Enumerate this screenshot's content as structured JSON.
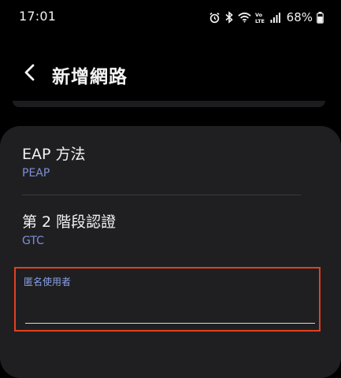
{
  "status_bar": {
    "time": "17:01",
    "battery_percent": "68%",
    "icons": [
      "alarm-icon",
      "bluetooth-icon",
      "wifi-icon",
      "volte-icon",
      "signal-icon",
      "battery-icon"
    ],
    "volte_text": "VoLTE"
  },
  "header": {
    "title": "新增網路",
    "back_icon": "chevron-left-icon"
  },
  "settings": {
    "eap_method": {
      "label": "EAP 方法",
      "value": "PEAP"
    },
    "phase2_auth": {
      "label": "第 2 階段認證",
      "value": "GTC"
    },
    "anonymous_identity": {
      "label": "匿名使用者",
      "value": ""
    }
  },
  "colors": {
    "background": "#000000",
    "card": "#1f1f22",
    "value_accent": "#7d8fd8",
    "label_accent": "#8aa0e4",
    "highlight_border": "#e3401f"
  }
}
